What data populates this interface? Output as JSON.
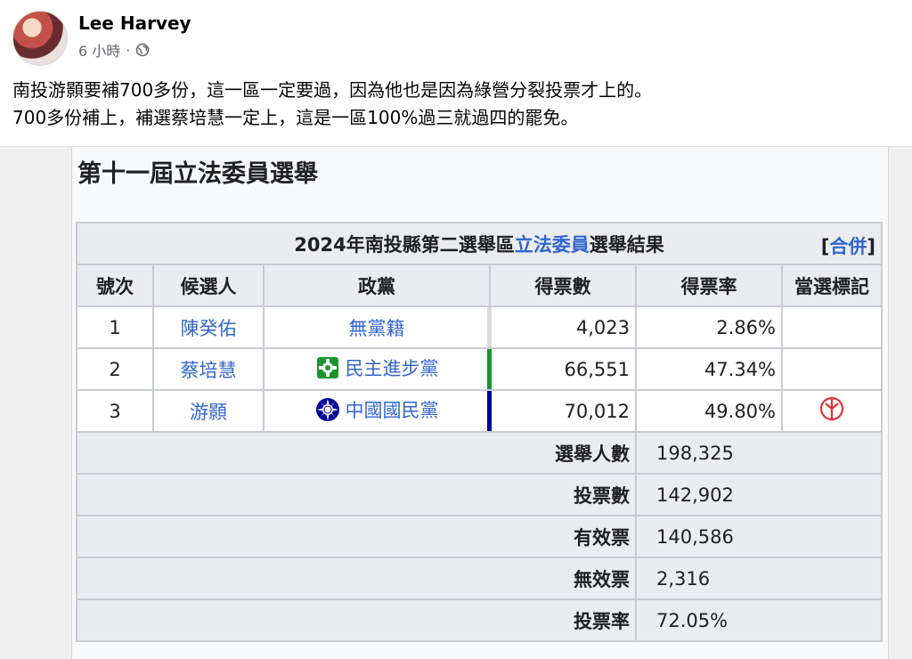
{
  "post": {
    "author": "Lee Harvey",
    "time": "6 小時",
    "dot": "·",
    "privacy_icon": "globe-icon",
    "lines": [
      "南投游顥要補700多份，這一區一定要過，因為他也是因為綠營分裂投票才上的。",
      "700多份補上，補選蔡培慧一定上，這是一區100%過三就過四的罷免。"
    ]
  },
  "wiki": {
    "section_title": "第十一屆立法委員選舉",
    "caption_prefix": "2024年南投縣第二選舉區",
    "caption_link": "立法委員",
    "caption_suffix": "選舉結果",
    "merge_open": "[",
    "merge_label": "合併",
    "merge_close": "]",
    "headers": [
      "號次",
      "候選人",
      "政黨",
      "得票數",
      "得票率",
      "當選標記"
    ],
    "candidates": [
      {
        "no": "1",
        "name": "陳癸佑",
        "party": "無黨籍",
        "party_icon": "",
        "votes": "4,023",
        "pct": "2.86%",
        "bar_color": "#dcdcdc",
        "elected": false
      },
      {
        "no": "2",
        "name": "蔡培慧",
        "party": "民主進步黨",
        "party_icon": "dpp-logo-icon",
        "votes": "66,551",
        "pct": "47.34%",
        "bar_color": "#1b9431",
        "elected": false
      },
      {
        "no": "3",
        "name": "游顥",
        "party": "中國國民黨",
        "party_icon": "kmt-logo-icon",
        "votes": "70,012",
        "pct": "49.80%",
        "bar_color": "#000095",
        "elected": true
      }
    ],
    "summary": [
      {
        "label": "選舉人數",
        "value": "198,325"
      },
      {
        "label": "投票數",
        "value": "142,902"
      },
      {
        "label": "有效票",
        "value": "140,586"
      },
      {
        "label": "無效票",
        "value": "2,316"
      },
      {
        "label": "投票率",
        "value": "72.05%"
      }
    ],
    "colors": {
      "link": "#3366cc",
      "header_bg": "#eaecf0",
      "elected_mark": "#d33"
    }
  }
}
